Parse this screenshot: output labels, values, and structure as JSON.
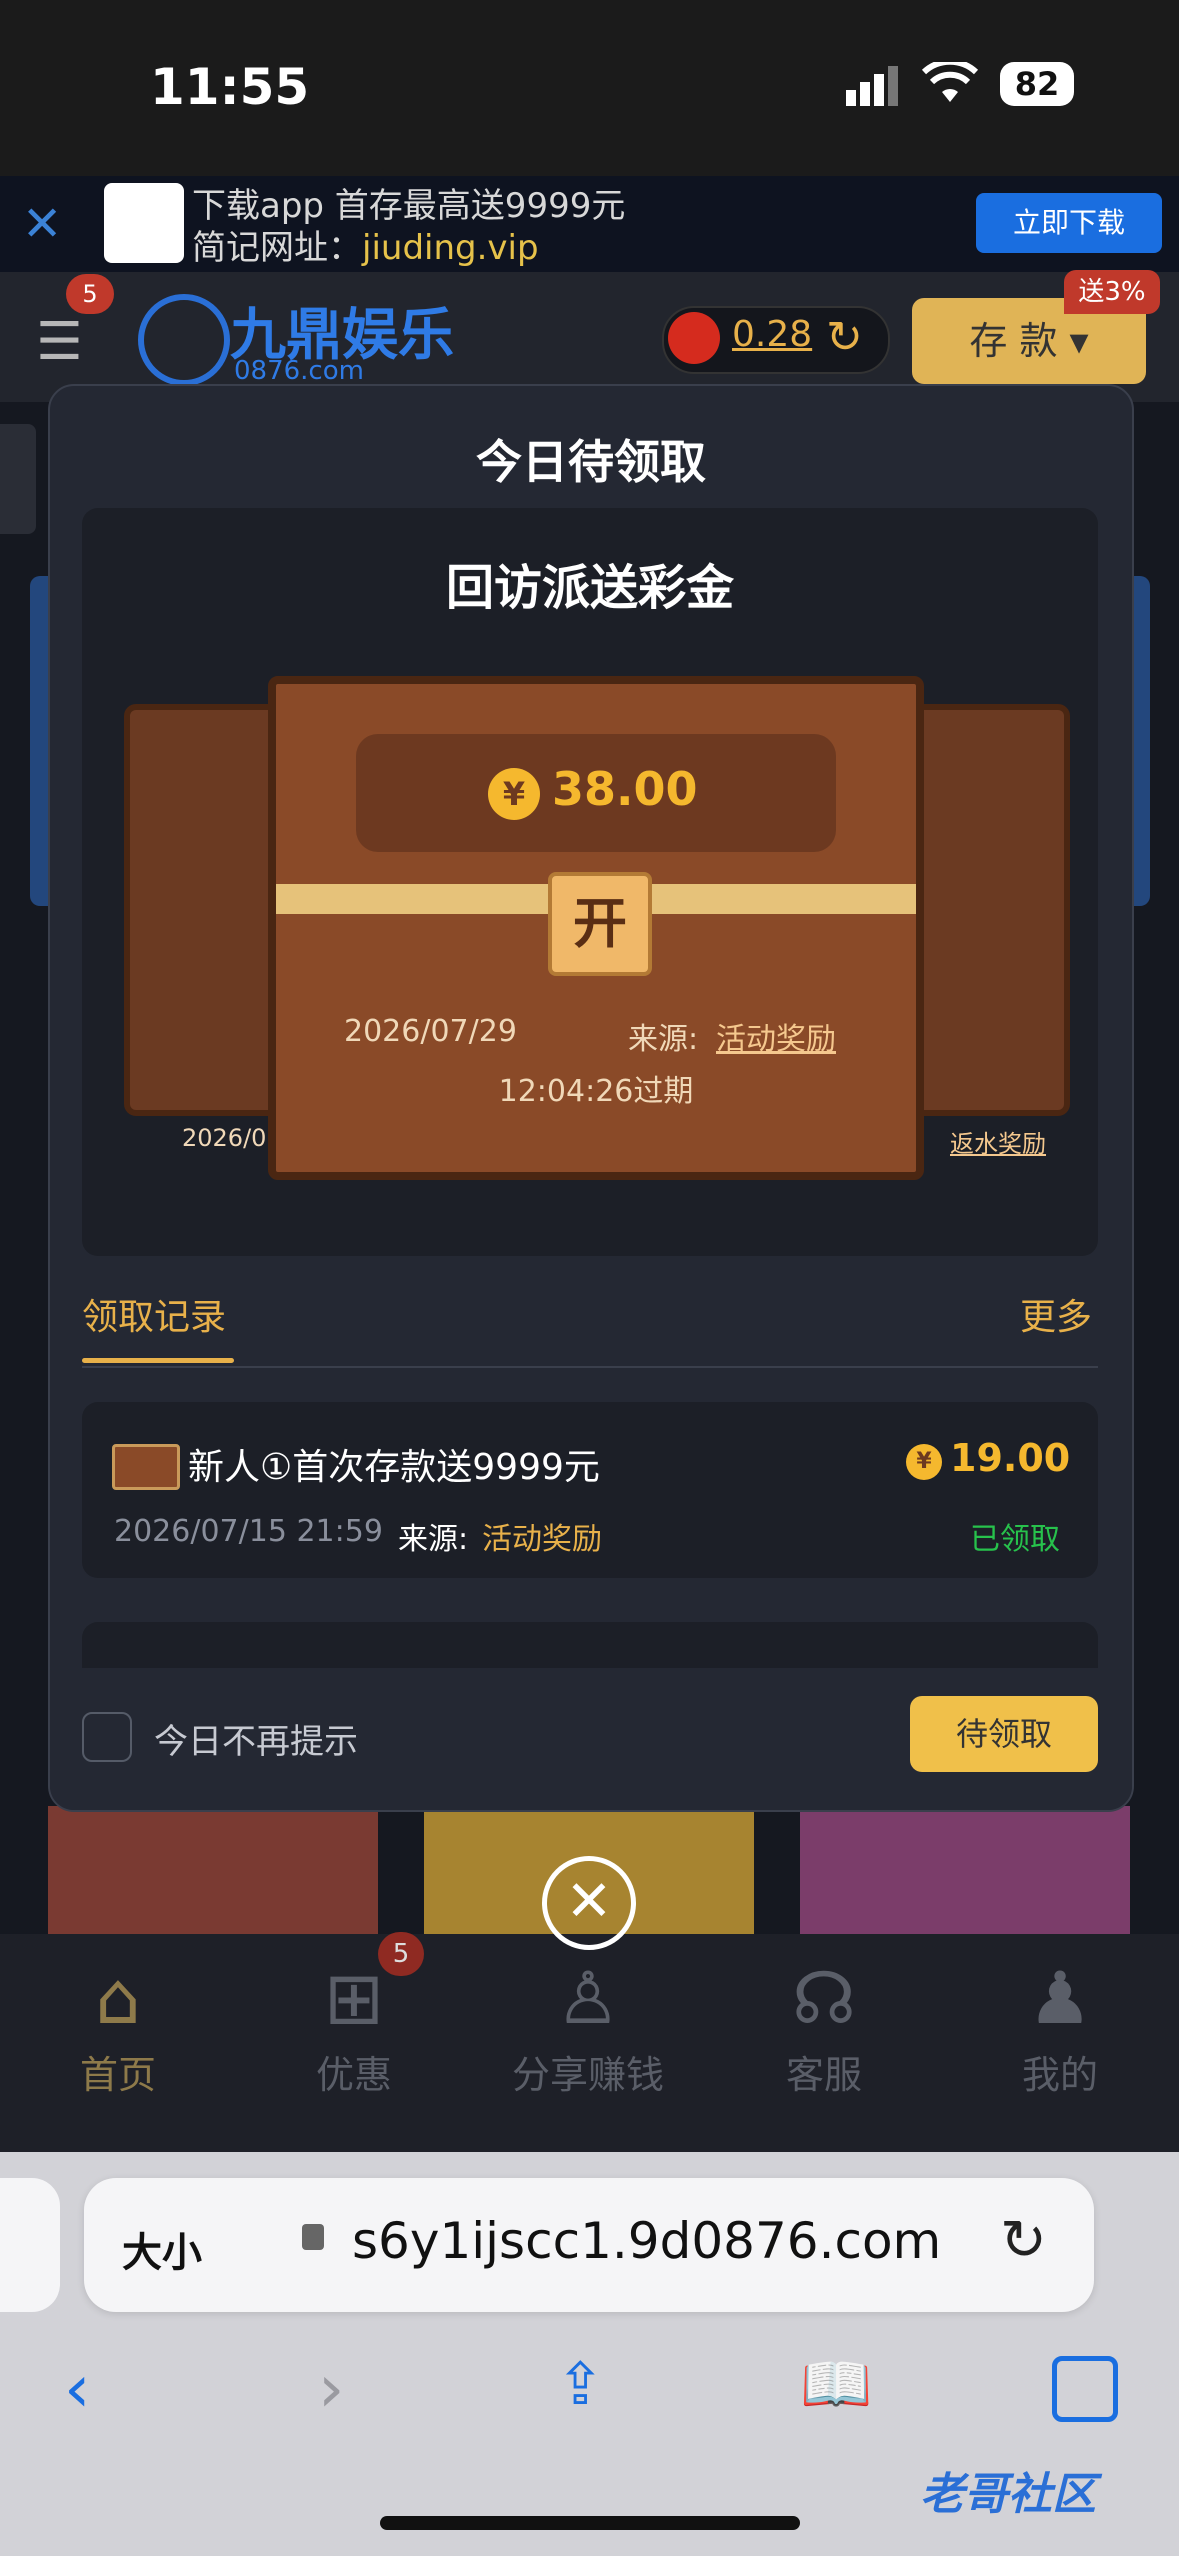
{
  "status_bar": {
    "time": "11:55",
    "battery": "82"
  },
  "banner": {
    "line1": "下载app 首存最高送9999元",
    "line2_prefix": "简记网址：",
    "line2_url": "jiuding.vip",
    "button": "立即下载"
  },
  "header": {
    "menu_badge": "5",
    "brand_name": "九鼎娱乐",
    "brand_sub": "0876.com",
    "balance": "0.28",
    "deposit_label": "存 款",
    "deposit_tag": "送3%"
  },
  "modal": {
    "title": "今日待领取",
    "reward_title": "回访派送彩金",
    "currency_symbol": "¥",
    "amount": "38.00",
    "lock_label": "开",
    "date": "2026/07/29",
    "source_label": "来源:",
    "source": "活动奖励",
    "expire": "12:04:26过期",
    "side_left_date": "2026/07",
    "side_right_source": "返水奖励",
    "records_tab": "领取记录",
    "more": "更多",
    "records": [
      {
        "title": "新人①首次存款送9999元",
        "amount": "19.00",
        "time": "2026/07/15 21:59",
        "source_label": "来源:",
        "source": "活动奖励",
        "status": "已领取"
      }
    ],
    "no_remind": "今日不再提示",
    "claim_button": "待领取"
  },
  "bottom_nav": {
    "items": [
      {
        "label": "首页",
        "icon": "home-icon"
      },
      {
        "label": "优惠",
        "icon": "gift-icon"
      },
      {
        "label": "分享赚钱",
        "icon": "share-icon"
      },
      {
        "label": "客服",
        "icon": "headset-icon"
      },
      {
        "label": "我的",
        "icon": "user-icon"
      }
    ],
    "promo_badge": "5"
  },
  "browser": {
    "size_label": "大小",
    "url": "s6y1ijscc1.9d0876.com"
  },
  "watermark": "老哥社区"
}
